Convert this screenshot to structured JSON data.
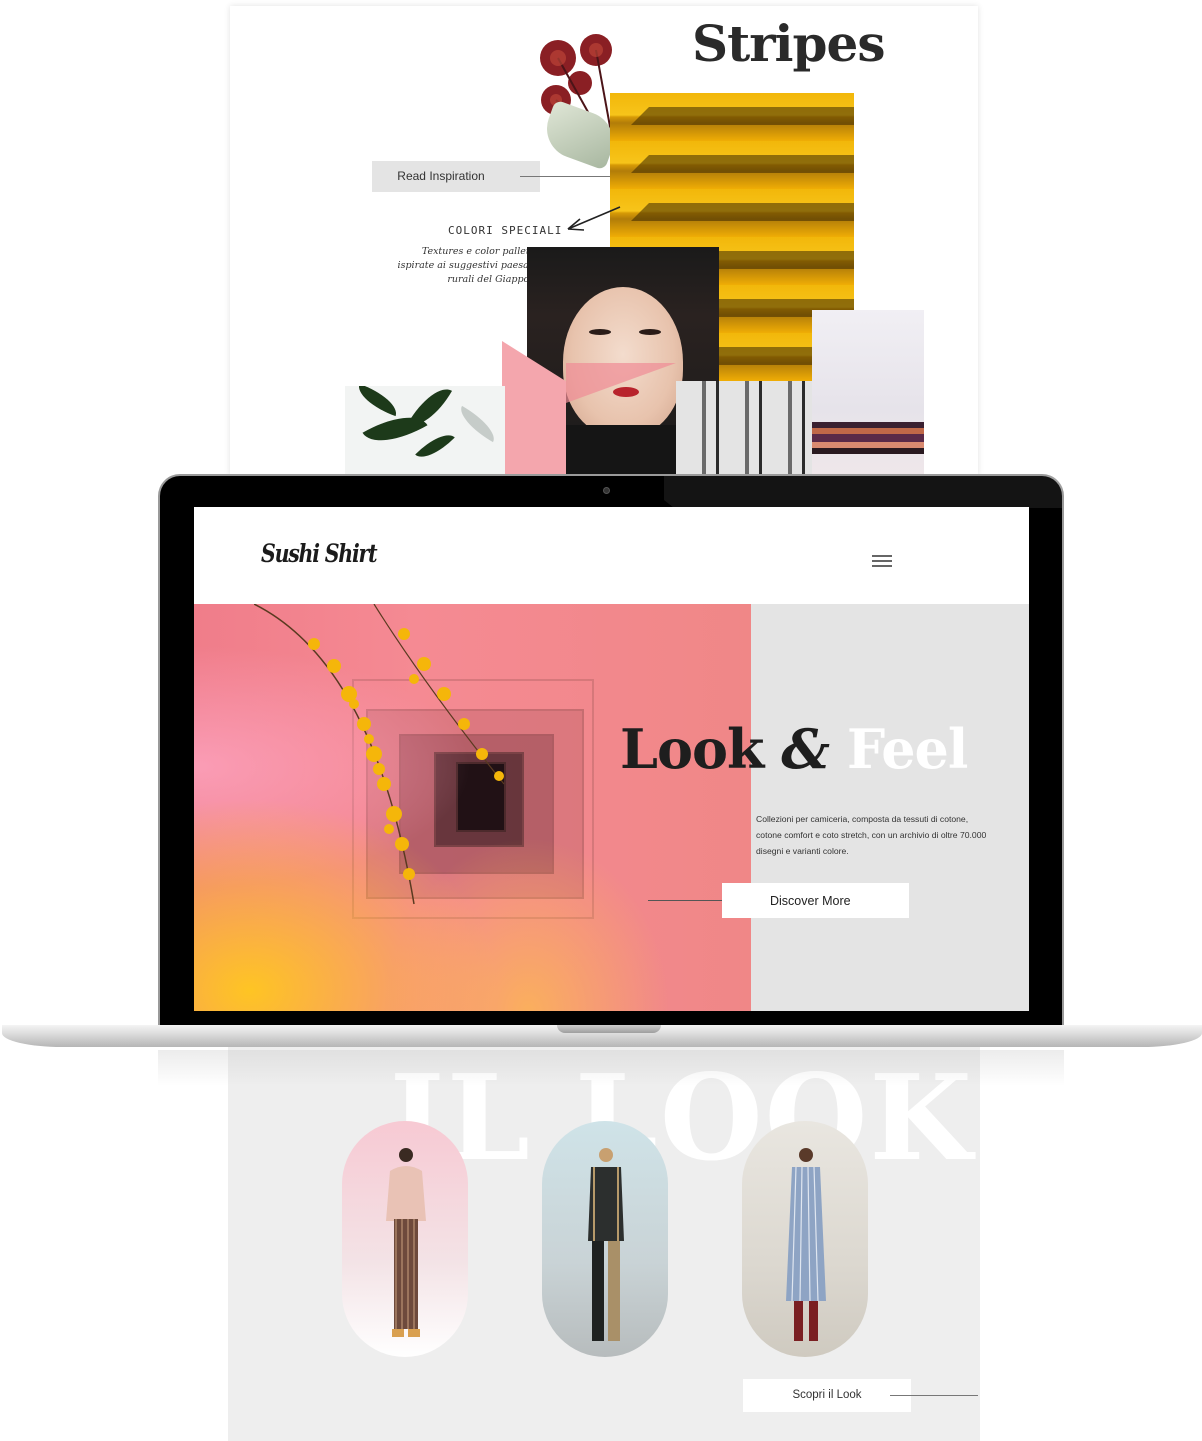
{
  "moodboard_top": {
    "title": "Stripes",
    "read_button": "Read Inspiration",
    "handwritten_heading": "COLORI SPECIALI",
    "handwritten_lines": [
      "Textures e color pallettes",
      "ispirate ai suggestivi paesaggi",
      "rurali del Giappone."
    ]
  },
  "site": {
    "logo": "Sushi Shirt",
    "hero": {
      "title_part1": "Look",
      "title_part2": "&",
      "title_part3": "Feel",
      "description": "Collezioni per camiceria, composta da tessuti di cotone, cotone comfort e coto stretch, con un archivio di oltre 70.000 disegni e varianti colore.",
      "cta": "Discover More"
    }
  },
  "moodboard_bottom": {
    "watermark": "IL LOOK",
    "cta": "Scopri il Look"
  },
  "colors": {
    "hero_pink": "#f07d8a",
    "hero_gray": "#e4e4e4",
    "stripes_yellow": "#f2b70a",
    "ink": "#1e1e1e"
  },
  "icons": {
    "menu": "hamburger-menu-icon",
    "arrow": "hand-drawn-arrow-icon",
    "camera": "webcam-icon"
  }
}
